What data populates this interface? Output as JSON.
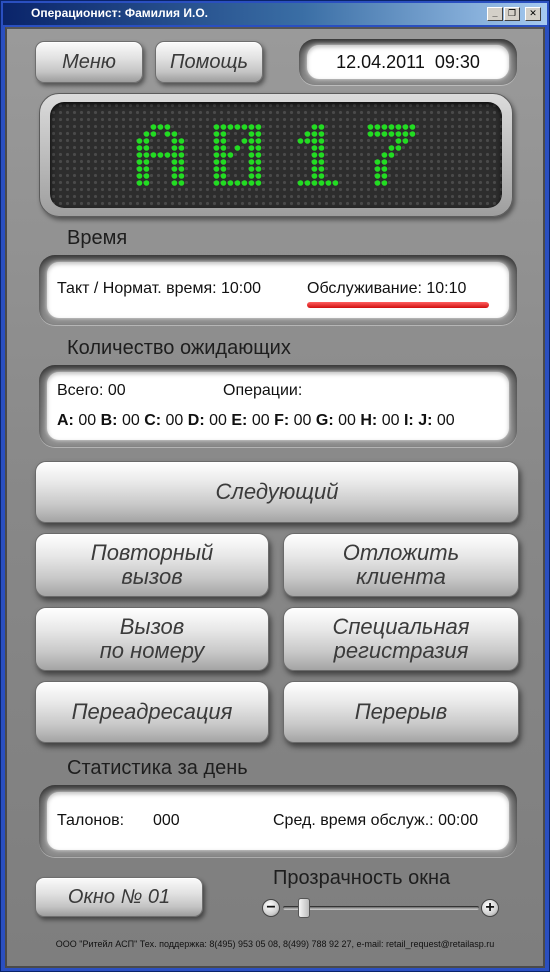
{
  "window": {
    "title": "Операционист: Фамилия И.О.",
    "controls": {
      "minimize": "_",
      "restore": "❐",
      "close": "✕"
    }
  },
  "top": {
    "menu_label": "Меню",
    "help_label": "Помощь",
    "datetime": "12.04.2011  09:30"
  },
  "ticket_display": {
    "number": "A017",
    "led_color": "#22dd22"
  },
  "time_section": {
    "label": "Время",
    "takt": "Такт / Нормат. время: 10:00",
    "service": "Обслуживание: 10:10",
    "bar_color": "#d01010"
  },
  "queue_section": {
    "label": "Количество ожидающих",
    "total": "Всего: 00",
    "operations": "Операции:",
    "counts": [
      {
        "letter": "A:",
        "value": "00"
      },
      {
        "letter": "B:",
        "value": "00"
      },
      {
        "letter": "C:",
        "value": "00"
      },
      {
        "letter": "D:",
        "value": "00"
      },
      {
        "letter": "E:",
        "value": "00"
      },
      {
        "letter": "F:",
        "value": "00"
      },
      {
        "letter": "G:",
        "value": "00"
      },
      {
        "letter": "H:",
        "value": "00"
      },
      {
        "letter": "I:",
        "value": ""
      },
      {
        "letter": "J:",
        "value": "00"
      }
    ]
  },
  "actions": {
    "next": "Следующий",
    "repeat_line1": "Повторный",
    "repeat_line2": "вызов",
    "postpone_line1": "Отложить",
    "postpone_line2": "клиента",
    "call_number_line1": "Вызов",
    "call_number_line2": "по номеру",
    "special_line1": "Специальная",
    "special_line2": "регистразия",
    "redirect": "Переадресация",
    "break": "Перерыв"
  },
  "stats_section": {
    "label": "Статистика за день",
    "tickets_label": "Талонов:",
    "tickets_value": "000",
    "avg_time": "Сред. время обслуж.: 00:00"
  },
  "bottom": {
    "window_label": "Окно № 01",
    "transparency_label": "Прозрачность окна",
    "transparency_value": 0.05,
    "minus": "−",
    "plus": "+",
    "footer": "ООО \"Ритейл АСП\" Тех. поддержка: 8(495) 953 05 08, 8(499) 788 92 27, e-mail: retail_request@retailasp.ru"
  }
}
